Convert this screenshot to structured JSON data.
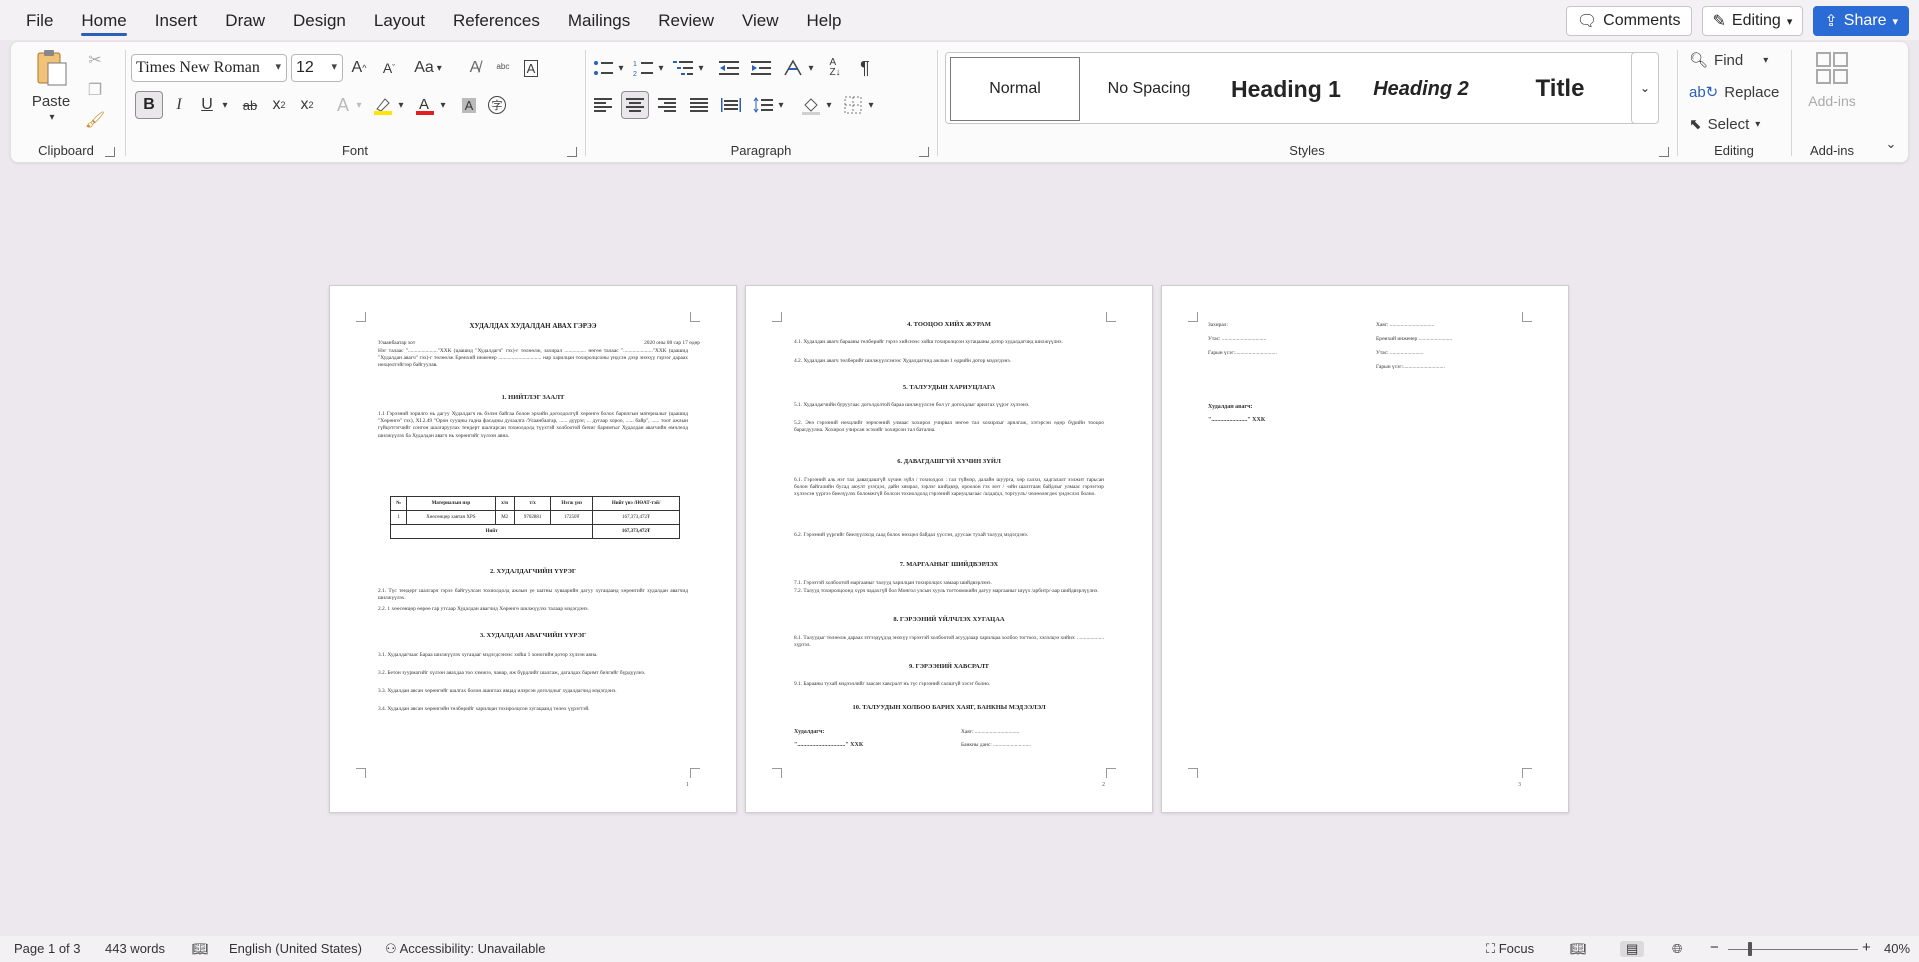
{
  "menu": {
    "items": [
      "File",
      "Home",
      "Insert",
      "Draw",
      "Design",
      "Layout",
      "References",
      "Mailings",
      "Review",
      "View",
      "Help"
    ],
    "active": "Home",
    "comments": "Comments",
    "editing": "Editing",
    "share": "Share"
  },
  "ribbon": {
    "clipboard": {
      "label": "Clipboard",
      "paste": "Paste"
    },
    "font": {
      "label": "Font",
      "family": "Times New Roman",
      "size": "12",
      "case": "Aa",
      "bold": "B",
      "italic": "I",
      "underline": "U",
      "strike": "ab",
      "subscript": "x",
      "superscript": "x"
    },
    "paragraph": {
      "label": "Paragraph"
    },
    "styles": {
      "label": "Styles",
      "normal": "Normal",
      "no_spacing": "No Spacing",
      "heading1": "Heading 1",
      "heading2": "Heading 2",
      "title": "Title"
    },
    "editing": {
      "label": "Editing",
      "find": "Find",
      "replace": "Replace",
      "select": "Select"
    },
    "addins": {
      "label": "Add-ins",
      "button": "Add-ins"
    }
  },
  "pages": {
    "p1": {
      "title": "ХУДАЛДАХ ХУДАЛДАН АВАХ ГЭРЭЭ",
      "city": "Улаанбаатар хот",
      "date": "2020 оны 08 сар 17 өдөр",
      "intro": "Нэг талаас \"......................\"ХХК (цаашид \"Худалдагч\" гэх)-г төлөөлж, захирал ................ нөгөө талаас \"......................\"ХХК (цаашид \"Худалдан авагч\" гэх)-г төлөөлж Ерөнхий инженер ................................ нар харилцан тохиролцсоны үндсэн дээр энэхүү гэрээг дараах нөхцөлтэйгээр байгуулав.",
      "s1": "1.  НИЙТЛЭГ ЗААЛТ",
      "s1_text": "1.1 Гэрээний зорилго нь дагуу Худалдагч нь бэлэн байгаа болон эрхийн доголдолгүй хөрөнгө болох барилгын материалыг (цаашид \"Хөрөнгө\" гэх), ХI.2.49 \"Орон сууцны гадна фасадны дулаалга /Улаанбаатар, ...... дүүрэг, ... дугаар хороо, ...... байр\", ...... тоот ажлын гүйцэтгэгчийг сонгон шалгаруулах тендерт шалгарсан тохиолдолд түүхтэй холбоотой бичиг баримтыг Худалдан авагчийн өмчлөлд шилжүүлэх ба Худалдан авагч нь хөрөнгийг хүлээн авна.",
      "table": {
        "headers": [
          "№",
          "Материалын нэр",
          "х/н",
          "т/х",
          "Нэгж үнэ",
          "Нийт үнэ /НӨАТ-тэй/"
        ],
        "row": [
          "1",
          "Хөөсөнцөр хавтан XPS",
          "М2",
          "9702881",
          "17250₮",
          "167,373,472₮"
        ],
        "total_label": "Нийт",
        "total_value": "167,373,472₮"
      },
      "s2": "2.  ХУДАЛДАГЧИЙН ҮҮРЭГ",
      "s2_1": "2.1.    Түс тендерт шалгарч гэрээ байгуулсан тохиолдолд ажлын үе шатны хуваарийн дагуу хугацаанд хөрөнгийг худалдан авагчид шилжүүлэх.",
      "s2_2": "2.2.    1 хөөсөнцөр өөрөө гар утсаар Худалдан авагчид Хөрөнгө шилжүүлэх талаар мэдэгдэнэ.",
      "s3": "3.  ХУДАЛДАН АВАГЧИЙН ҮҮРЭГ",
      "s3_1": "3.1.    Худалдагчаас Бараа шилжүүлэх хугацааг мэдэгдсэнээс хойш 1 хоногийн дотор хүлээн авна.",
      "s3_2": "3.2.    Бетон зуурмагийг хүлээн авахдаа тоо хэмжээ, чанар, иж бүрдлийг шалгаж, дагалдах баримт бичгийг бүрдүүлнэ.",
      "s3_3": "3.3.    Худалдан авсан хөрөнгийг шалгах болон ашиглах явцад илэрсэн доголдлыг худалдагчид мэдэгдэнэ.",
      "s3_4": "3.4.    Худалдан авсан хөрөнгийн төлбөрийг харилцан тохиролцсон хугацаанд төлөх үүрэгтэй.",
      "num": "1"
    },
    "p2": {
      "s4": "4.  ТООЦОО ХИЙХ ЖУРАМ",
      "s4_1": "4.1.    Худалдан авагч барааны төлбөрийг гэрээ хийснээс хойш тохиролцсон хугацааны дотор худалдагчид шилжүүлнэ.",
      "s4_2": "4.2.    Худалдан авагч төлбөрийг шилжүүлсэнээс Худалдагчид ажлын 1 өдрийн дотор мэдэгдэнэ.",
      "s5": "5.  ТАЛУУДЫН ХАРИУЦЛАГА",
      "s5_1": "5.1.    Худалдагчийн буруугаас доголдолтой бараа шилжүүлсэн бол уг доголдлыг арилгах үүрэг хүлээнэ.",
      "s5_2": "5.2.    Энэ гэрээний нөхцлийг зөрчсөний улмаас хохирол учирвал нөгөө тал хохирлыг арилгаж, хэтэрсэн өдөр бүрийн тооцоо барагдуулна. Хохирол учирсан эсэхийг хохирсон тал батална.",
      "s6": "6.  ДАВАГДАШГҮЙ ХҮЧИН ЗҮЙЛ",
      "s6_1": "6.1.    Гэрээний аль нэг тал давагдашгүй хүчин зүйл / тохиолдол : гал түймэр, далайн шуурга, хөр салхи, хадгалалт ээлжит тарьсан болон байгалийн бусад аюулт үзэгдэл, дайн хямрал, зэрлэг шийдвэр, ороолон гэх мэт / -ийн шалтгаан байдлыг улмаас гэрээгээр хүлээсэн үүргээ биелүүлэх боломжгүй болсон тохиолдолд гэрээний хариуцлагаас /алдагдл, торгуулъ/ чөлөөлөгдөх үндэслэл болно.",
      "s6_2": "6.2.    Гэрээний үүргийг биелүүлэхэд саад болох нөхцөл байдал үүссэн, дуусаж тухай талууд мэдэгдэнэ.",
      "s7": "7.  МАРГААНЫГ ШИЙДВЭРЛЭХ",
      "s7_1": "7.1.    Гэрээтэй холбоотой маргааныг талууд харилцан тохиролцох замаар шийдвэрлэнэ.",
      "s7_2": "7.2.    Талууд тохиролцоонд хүрч чадахгүй бол Монгол улсын хууль тогтоомжийн дагуу маргааныг шүүх /арбитр/-аар шийдвэрлүүлнэ.",
      "s8": "8.  ГЭРЭЭНИЙ ҮЙЛЧЛЭХ ХУГАЦАА",
      "s8_1": "8.1.    Талуудыг төлөөлж дараах этгээдүүдэд энэхүү гэрээтэй холбоотой асуудлаар харилцаа холбоо тогтоох, хэлэлцээ хийнэ: .................... хүртэл.",
      "s9": "9.  ГЭРЭЭНИЙ ХАВСРАЛТ",
      "s9_1": "9.1.    Барааны тухай мэдээллийг заасан хавсралт нь түс гэрээний салшгүй хэсэг болно.",
      "s10": "10. ТАЛУУДЫН ХОЛБОО БАРИХ ХАЯГ, БАНКНЫ МЭДЭЭЛЭЛ",
      "seller_label": "Худалдагч:",
      "seller_name": "\"................................\" ХХК",
      "address": "Хаяг: .................................",
      "bank": "Банкны данс: ............................",
      "num": "2"
    },
    "p3": {
      "director": "Захирал:",
      "phone": "Утас: .................................",
      "signature": "Гарын үсэг:...............................",
      "address": "Хаяг: .................................",
      "engineer": "Ерөнхий инженер .........................",
      "phone2": "Утас: .........................",
      "signature2": "Гарын үсэг:...............................",
      "buyer_label": "Худалдан авагч:",
      "buyer_name": "\"........................\" ХХК",
      "num": "3"
    }
  },
  "status": {
    "page": "Page 1 of 3",
    "words": "443 words",
    "language": "English (United States)",
    "accessibility": "Accessibility: Unavailable",
    "focus": "Focus",
    "zoom": "40%"
  }
}
